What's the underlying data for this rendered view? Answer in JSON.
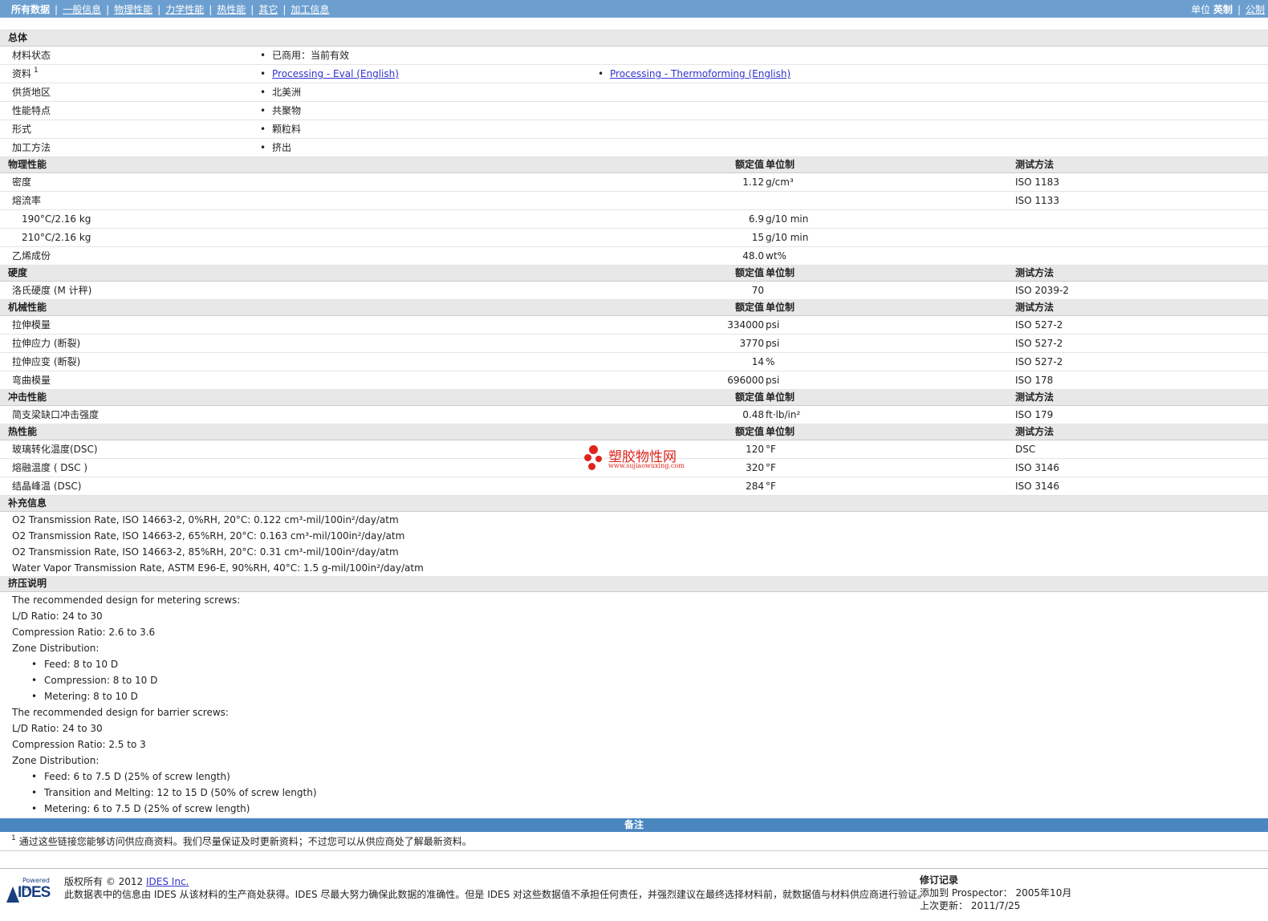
{
  "topbar": {
    "nav": [
      "所有数据",
      "一般信息",
      "物理性能",
      "力学性能",
      "热性能",
      "其它",
      "加工信息"
    ],
    "units_label": "单位",
    "unit_current": "英制",
    "unit_other": "公制"
  },
  "headers": {
    "nominal": "额定值",
    "unit": "单位制",
    "method": "测试方法"
  },
  "general": {
    "title": "总体",
    "rows": [
      {
        "label": "材料状态",
        "values": [
          "已商用：当前有效"
        ]
      },
      {
        "label": "资料",
        "sup": "1",
        "links": [
          "Processing - Eval (English)",
          "Processing - Thermoforming (English)"
        ]
      },
      {
        "label": "供货地区",
        "values": [
          "北美洲"
        ]
      },
      {
        "label": "性能特点",
        "values": [
          "共聚物"
        ]
      },
      {
        "label": "形式",
        "values": [
          "颗粒料"
        ]
      },
      {
        "label": "加工方法",
        "values": [
          "挤出"
        ]
      }
    ]
  },
  "physical": {
    "title": "物理性能",
    "rows": [
      {
        "label": "密度",
        "value": "1.12",
        "unit": "g/cm³",
        "method": "ISO 1183"
      },
      {
        "label": "熔流率",
        "value": "",
        "unit": "",
        "method": "ISO 1133"
      },
      {
        "label": "190°C/2.16 kg",
        "sub": true,
        "value": "6.9",
        "unit": "g/10 min",
        "method": ""
      },
      {
        "label": "210°C/2.16 kg",
        "sub": true,
        "value": "15",
        "unit": "g/10 min",
        "method": ""
      },
      {
        "label": "乙烯成份",
        "value": "48.0",
        "unit": "wt%",
        "method": ""
      }
    ]
  },
  "hardness": {
    "title": "硬度",
    "rows": [
      {
        "label": "洛氏硬度 (M 计秤)",
        "value": "70",
        "unit": "",
        "method": "ISO 2039-2"
      }
    ]
  },
  "mechanical": {
    "title": "机械性能",
    "rows": [
      {
        "label": "拉伸模量",
        "value": "334000",
        "unit": "psi",
        "method": "ISO 527-2"
      },
      {
        "label": "拉伸应力 (断裂)",
        "value": "3770",
        "unit": "psi",
        "method": "ISO 527-2"
      },
      {
        "label": "拉伸应变 (断裂)",
        "value": "14",
        "unit": "%",
        "method": "ISO 527-2"
      },
      {
        "label": "弯曲模量",
        "value": "696000",
        "unit": "psi",
        "method": "ISO 178"
      }
    ]
  },
  "impact": {
    "title": "冲击性能",
    "rows": [
      {
        "label": "简支梁缺口冲击强度",
        "value": "0.48",
        "unit": "ft·lb/in²",
        "method": "ISO 179"
      }
    ]
  },
  "thermal": {
    "title": "热性能",
    "rows": [
      {
        "label": "玻璃转化温度(DSC)",
        "value": "120",
        "unit": "°F",
        "method": "DSC"
      },
      {
        "label": "熔融温度 ( DSC )",
        "value": "320",
        "unit": "°F",
        "method": "ISO 3146"
      },
      {
        "label": "结晶峰温 (DSC)",
        "value": "284",
        "unit": "°F",
        "method": "ISO 3146"
      }
    ]
  },
  "supplement": {
    "title": "补充信息",
    "lines": [
      "O2 Transmission Rate, ISO 14663-2, 0%RH, 20°C: 0.122 cm³-mil/100in²/day/atm",
      "O2 Transmission Rate, ISO 14663-2, 65%RH, 20°C: 0.163 cm³-mil/100in²/day/atm",
      "O2 Transmission Rate, ISO 14663-2, 85%RH, 20°C: 0.31 cm³-mil/100in²/day/atm",
      "Water Vapor Transmission Rate, ASTM E96-E, 90%RH, 40°C: 1.5 g-mil/100in²/day/atm"
    ]
  },
  "extrusion": {
    "title": "挤压说明",
    "lines": [
      {
        "text": "The recommended design for metering screws:"
      },
      {
        "text": "L/D Ratio: 24 to 30"
      },
      {
        "text": "Compression Ratio: 2.6 to 3.6"
      },
      {
        "text": "Zone Distribution:"
      },
      {
        "text": "Feed: 8 to 10 D",
        "bullet": true
      },
      {
        "text": "Compression: 8 to 10 D",
        "bullet": true
      },
      {
        "text": "Metering: 8 to 10 D",
        "bullet": true
      },
      {
        "text": "The recommended design for barrier screws:"
      },
      {
        "text": "L/D Ratio: 24 to 30"
      },
      {
        "text": "Compression Ratio: 2.5 to 3"
      },
      {
        "text": "Zone Distribution:"
      },
      {
        "text": "Feed: 6 to 7.5 D (25% of screw length)",
        "bullet": true
      },
      {
        "text": "Transition and Melting: 12 to 15 D (50% of screw length)",
        "bullet": true
      },
      {
        "text": "Metering: 6 to 7.5 D (25% of screw length)",
        "bullet": true
      }
    ]
  },
  "notes": {
    "title": "备注",
    "sup": "1",
    "text": "通过这些链接您能够访问供应商资料。我们尽量保证及时更新资料；不过您可以从供应商处了解最新资料。"
  },
  "footer": {
    "logo_top": "Powered by",
    "logo_name": "IDES",
    "copyright_prefix": "版权所有 © 2012",
    "company_link": "IDES Inc.",
    "disclaimer": "此数据表中的信息由 IDES 从该材料的生产商处获得。IDES 尽最大努力确保此数据的准确性。但是 IDES 对这些数据值不承担任何责任，并强烈建议在最终选择材料前，就数据值与材料供应商进行验证。",
    "revision_title": "修订记录",
    "added_label": "添加到 Prospector：",
    "added_value": "2005年10月",
    "updated_label": "上次更新：",
    "updated_value": "2011/7/25"
  },
  "watermark": {
    "title": "塑胶物性网",
    "url": "www.sujiaowuxing.com",
    "color": "#e0241c"
  },
  "colors": {
    "topbar": "#6c9fd0",
    "notebar": "#4a86c0",
    "section": "#e8e8e8",
    "link": "#3333cc"
  }
}
